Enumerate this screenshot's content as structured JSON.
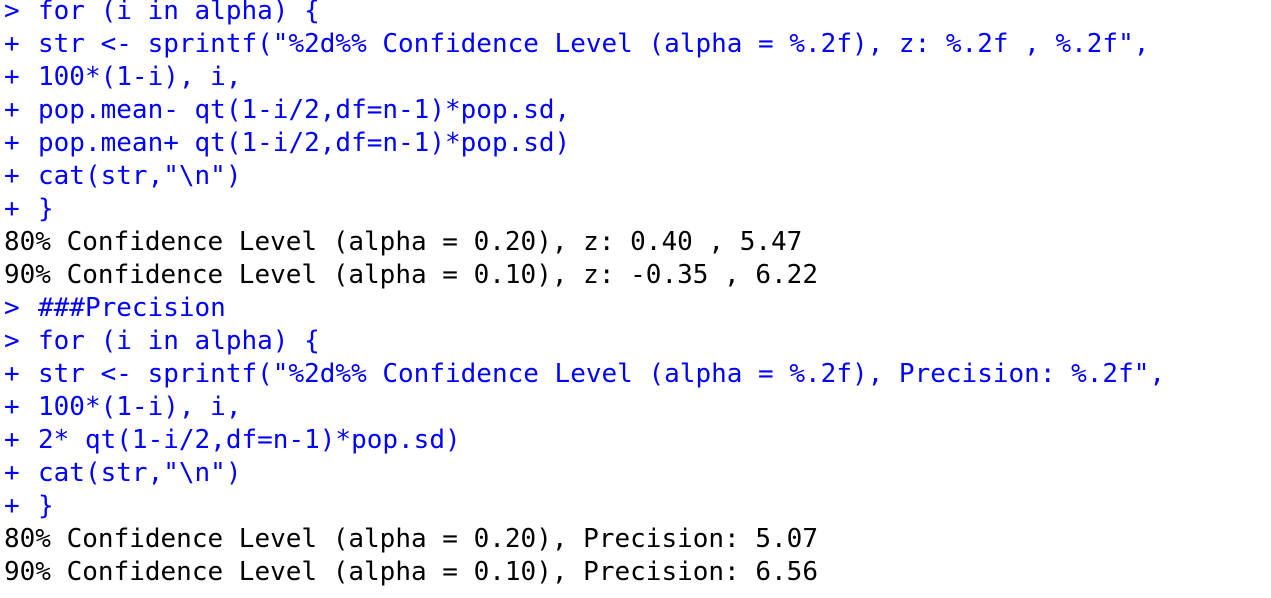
{
  "console": {
    "colors": {
      "input": "#0000ff",
      "output": "#000000",
      "background": "#ffffff"
    },
    "lines": [
      {
        "type": "input",
        "prompt": ">",
        "text": "for (i in alpha) {"
      },
      {
        "type": "input",
        "prompt": "+",
        "text": "str <- sprintf(\"%2d%% Confidence Level (alpha = %.2f), z: %.2f , %.2f\","
      },
      {
        "type": "input",
        "prompt": "+",
        "text": "100*(1-i), i,"
      },
      {
        "type": "input",
        "prompt": "+",
        "text": "pop.mean- qt(1-i/2,df=n-1)*pop.sd,"
      },
      {
        "type": "input",
        "prompt": "+",
        "text": "pop.mean+ qt(1-i/2,df=n-1)*pop.sd)"
      },
      {
        "type": "input",
        "prompt": "+",
        "text": "cat(str,\"\\n\")"
      },
      {
        "type": "input",
        "prompt": "+",
        "text": "}"
      },
      {
        "type": "output",
        "text": "80% Confidence Level (alpha = 0.20), z: 0.40 , 5.47"
      },
      {
        "type": "output",
        "text": "90% Confidence Level (alpha = 0.10), z: -0.35 , 6.22"
      },
      {
        "type": "input",
        "prompt": ">",
        "text": "###Precision"
      },
      {
        "type": "input",
        "prompt": ">",
        "text": "for (i in alpha) {"
      },
      {
        "type": "input",
        "prompt": "+",
        "text": "str <- sprintf(\"%2d%% Confidence Level (alpha = %.2f), Precision: %.2f\","
      },
      {
        "type": "input",
        "prompt": "+",
        "text": "100*(1-i), i,"
      },
      {
        "type": "input",
        "prompt": "+",
        "text": "2* qt(1-i/2,df=n-1)*pop.sd)"
      },
      {
        "type": "input",
        "prompt": "+",
        "text": "cat(str,\"\\n\")"
      },
      {
        "type": "input",
        "prompt": "+",
        "text": "}"
      },
      {
        "type": "output",
        "text": "80% Confidence Level (alpha = 0.20), Precision: 5.07"
      },
      {
        "type": "output",
        "text": "90% Confidence Level (alpha = 0.10), Precision: 6.56"
      }
    ]
  }
}
